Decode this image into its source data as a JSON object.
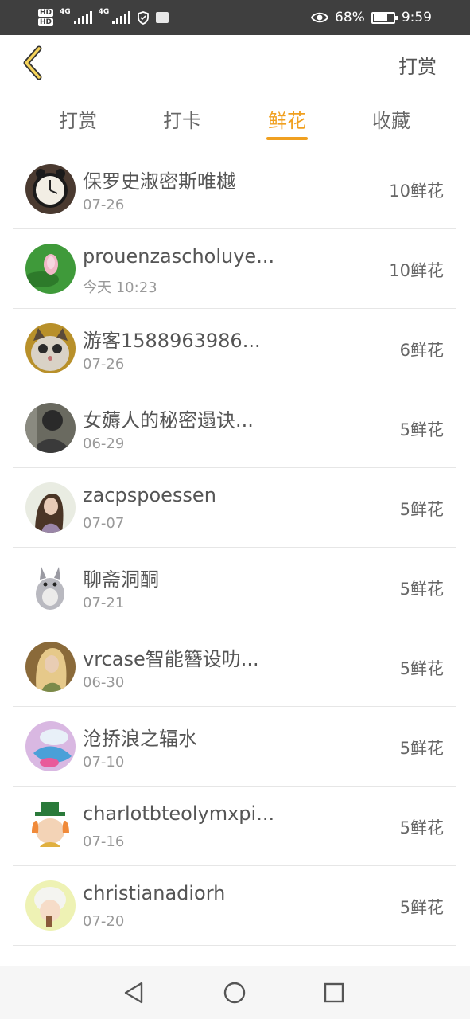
{
  "status_bar": {
    "hd1": "HD",
    "hd2": "HD",
    "net1": "4G",
    "net2": "4G",
    "battery": "68%",
    "time": "9:59"
  },
  "header": {
    "back_icon": "chevron-left-icon",
    "action_label": "打赏"
  },
  "tabs": [
    {
      "label": "打赏"
    },
    {
      "label": "打卡"
    },
    {
      "label": "鲜花"
    },
    {
      "label": "收藏"
    }
  ],
  "active_tab": "鲜花",
  "colors": {
    "accent": "#f0a020",
    "status_bar": "#3f3f3f"
  },
  "list": [
    {
      "name": "保罗史淑密斯唯樾",
      "date": "07-26",
      "amount": "10鲜花"
    },
    {
      "name": "prouenzascholuye...",
      "date": "今天 10:23",
      "amount": "10鲜花"
    },
    {
      "name": "游客1588963986...",
      "date": "07-26",
      "amount": "6鲜花"
    },
    {
      "name": "女薅人的秘密遢诀...",
      "date": "06-29",
      "amount": "5鲜花"
    },
    {
      "name": "zacpspoessen",
      "date": "07-07",
      "amount": "5鲜花"
    },
    {
      "name": "聊斋洞酮",
      "date": "07-21",
      "amount": "5鲜花"
    },
    {
      "name": "vrcase智能簪设叻...",
      "date": "06-30",
      "amount": "5鲜花"
    },
    {
      "name": "沧挢浪之辐水",
      "date": "07-10",
      "amount": "5鲜花"
    },
    {
      "name": "charlotbteolymxpi...",
      "date": "07-16",
      "amount": "5鲜花"
    },
    {
      "name": "christianadiorh",
      "date": "07-20",
      "amount": "5鲜花"
    }
  ],
  "navbar": {
    "back_icon": "triangle-back-icon",
    "home_icon": "circle-home-icon",
    "recents_icon": "square-recents-icon"
  }
}
